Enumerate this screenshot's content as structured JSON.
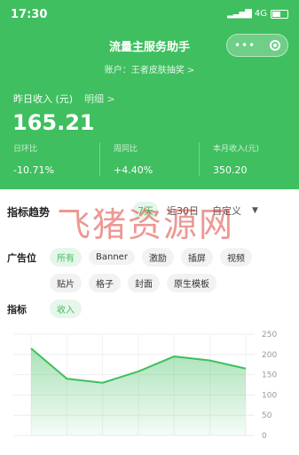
{
  "status_bar": {
    "time": "17:30",
    "network": "4G"
  },
  "header": {
    "title": "流量主服务助手",
    "account": "账户：王者皮肤抽奖 >",
    "capsule_more_icon": "more-dots-icon",
    "capsule_close_icon": "target-icon"
  },
  "income": {
    "label": "昨日收入 (元)",
    "detail": "明细 >",
    "value": "165.21"
  },
  "stats": [
    {
      "label": "日环比",
      "value": "-10.71%"
    },
    {
      "label": "周同比",
      "value": "+4.40%"
    },
    {
      "label": "本月收入(元)",
      "value": "350.20"
    }
  ],
  "trend": {
    "title": "指标趋势",
    "tabs": [
      {
        "label": "7天",
        "active": true
      },
      {
        "label": "近30日",
        "active": false
      },
      {
        "label": "自定义",
        "active": false
      }
    ]
  },
  "ad_position": {
    "label": "广告位",
    "row1": [
      "所有",
      "Banner",
      "激励",
      "插屏",
      "视频"
    ],
    "row2": [
      "贴片",
      "格子",
      "封面",
      "原生模板"
    ],
    "active": "所有"
  },
  "metric": {
    "label": "指标",
    "options": [
      "收入"
    ]
  },
  "chart_data": {
    "type": "area",
    "y_ticks": [
      "250",
      "200",
      "150",
      "100",
      "50",
      "0"
    ],
    "ylim": [
      0,
      250
    ],
    "values": [
      215,
      140,
      130,
      158,
      195,
      185,
      165
    ],
    "color": "#3fbf5f"
  },
  "watermark": "飞猪资源网"
}
